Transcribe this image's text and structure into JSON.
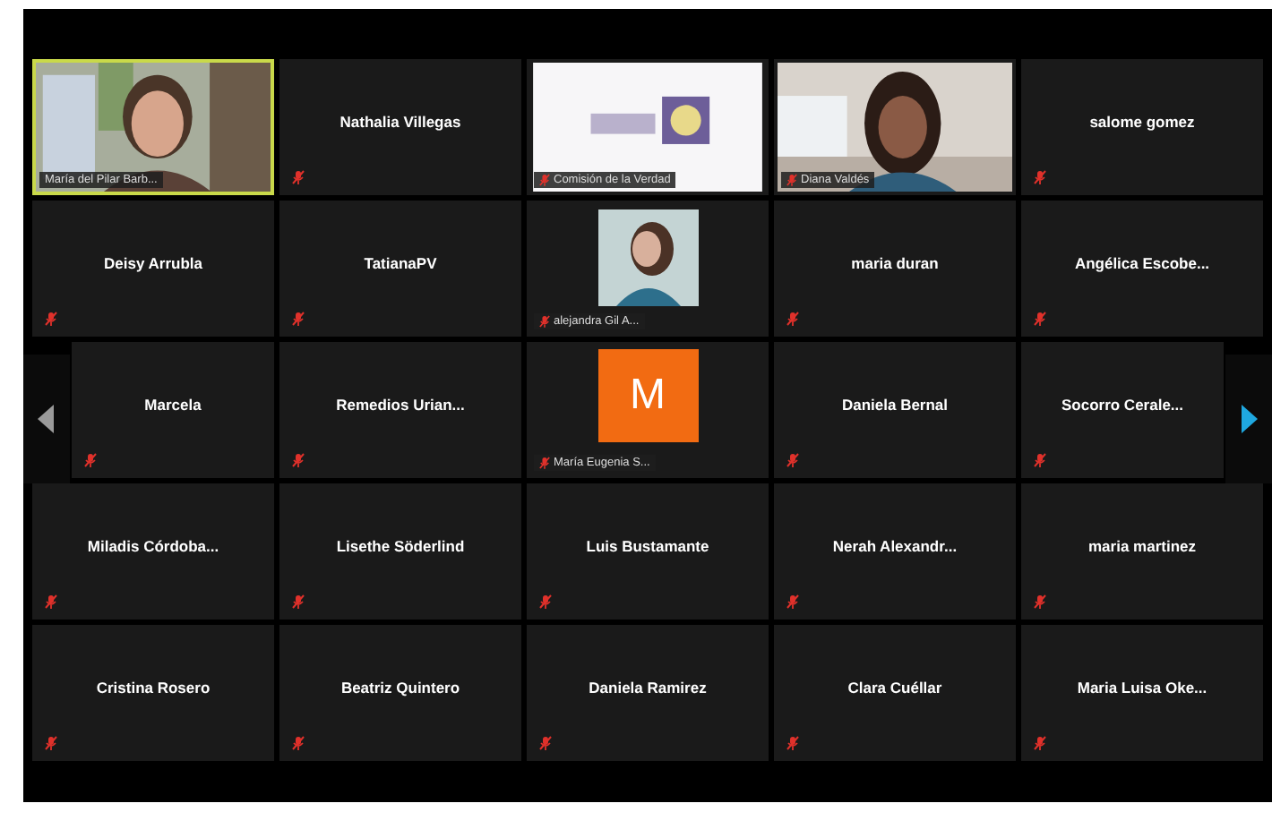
{
  "tiles": [
    {
      "kind": "video",
      "name": "María del Pilar Barb...",
      "muted": false,
      "selected": true
    },
    {
      "kind": "name",
      "name": "Nathalia Villegas",
      "muted": true,
      "selected": false
    },
    {
      "kind": "logo",
      "name": "Comisión de la Verdad",
      "muted": true,
      "selected": false
    },
    {
      "kind": "video",
      "name": "Diana Valdés",
      "muted": true,
      "selected": false
    },
    {
      "kind": "name",
      "name": "salome gomez",
      "muted": true,
      "selected": false
    },
    {
      "kind": "name",
      "name": "Deisy Arrubla",
      "muted": true,
      "selected": false
    },
    {
      "kind": "name",
      "name": "TatianaPV",
      "muted": true,
      "selected": false
    },
    {
      "kind": "avatar",
      "name": "alejandra Gil A...",
      "muted": true,
      "selected": false
    },
    {
      "kind": "name",
      "name": "maria duran",
      "muted": true,
      "selected": false
    },
    {
      "kind": "name",
      "name": "Angélica Escobe...",
      "muted": true,
      "selected": false
    },
    {
      "kind": "name",
      "name": "Marcela",
      "muted": true,
      "selected": false
    },
    {
      "kind": "name",
      "name": "Remedios Urian...",
      "muted": true,
      "selected": false
    },
    {
      "kind": "initial",
      "initial": "M",
      "name": "María Eugenia S...",
      "muted": true,
      "selected": false
    },
    {
      "kind": "name",
      "name": "Daniela Bernal",
      "muted": true,
      "selected": false
    },
    {
      "kind": "name",
      "name": "Socorro Cerale...",
      "muted": true,
      "selected": false
    },
    {
      "kind": "name",
      "name": "Miladis Córdoba...",
      "muted": true,
      "selected": false
    },
    {
      "kind": "name",
      "name": "Lisethe Söderlind",
      "muted": true,
      "selected": false
    },
    {
      "kind": "name",
      "name": "Luis Bustamante",
      "muted": true,
      "selected": false
    },
    {
      "kind": "name",
      "name": "Nerah Alexandr...",
      "muted": true,
      "selected": false
    },
    {
      "kind": "name",
      "name": "maria martinez",
      "muted": true,
      "selected": false
    },
    {
      "kind": "name",
      "name": "Cristina Rosero",
      "muted": true,
      "selected": false
    },
    {
      "kind": "name",
      "name": "Beatriz Quintero",
      "muted": true,
      "selected": false
    },
    {
      "kind": "name",
      "name": "Daniela Ramirez",
      "muted": true,
      "selected": false
    },
    {
      "kind": "name",
      "name": "Clara Cuéllar",
      "muted": true,
      "selected": false
    },
    {
      "kind": "name",
      "name": "Maria Luisa Oke...",
      "muted": true,
      "selected": false
    }
  ]
}
